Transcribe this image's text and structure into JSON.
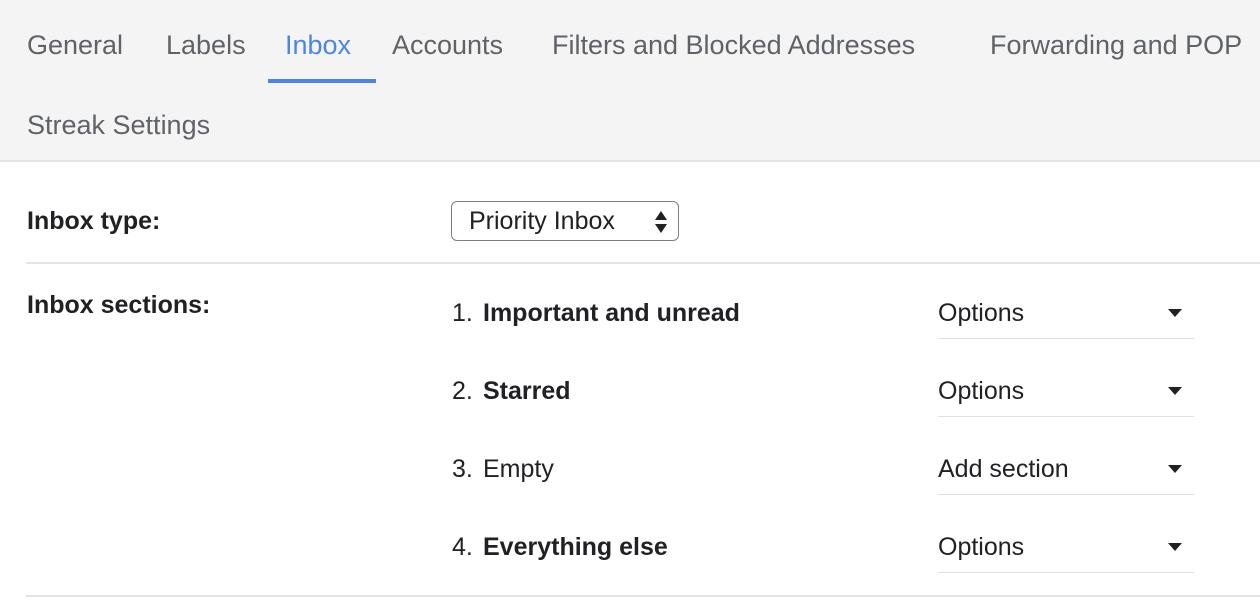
{
  "tabs": [
    {
      "label": "General"
    },
    {
      "label": "Labels"
    },
    {
      "label": "Inbox"
    },
    {
      "label": "Accounts"
    },
    {
      "label": "Filters and Blocked Addresses"
    },
    {
      "label": "Forwarding and POP"
    },
    {
      "label": "Streak Settings"
    }
  ],
  "active_tab": "Inbox",
  "inbox_type": {
    "label": "Inbox type:",
    "selected": "Priority Inbox"
  },
  "inbox_sections": {
    "label": "Inbox sections:",
    "items": [
      {
        "number": "1.",
        "name": "Important and unread",
        "action": "Options"
      },
      {
        "number": "2.",
        "name": "Starred",
        "action": "Options"
      },
      {
        "number": "3.",
        "name": "Empty",
        "action": "Add section"
      },
      {
        "number": "4.",
        "name": "Everything else",
        "action": "Options"
      }
    ]
  },
  "colors": {
    "accent": "#4a86e8",
    "tab_text": "#5f6368",
    "tabbar_bg": "#f4f4f4"
  }
}
